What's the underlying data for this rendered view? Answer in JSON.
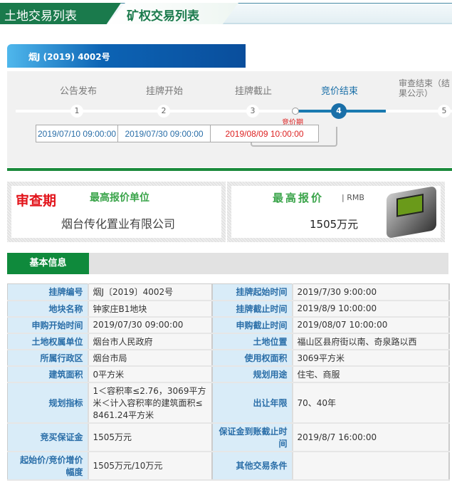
{
  "tabs": [
    "土地交易列表",
    "矿权交易列表"
  ],
  "title": "烟J (2019) 4002号",
  "steps": [
    {
      "label": "公告发布",
      "num": "1",
      "date": "2019/07/10 09:00:00"
    },
    {
      "label": "挂牌开始",
      "num": "2",
      "date": "2019/07/30 09:00:00"
    },
    {
      "label": "挂牌截止",
      "num": "3",
      "date": "2019/08/09 10:00:00"
    },
    {
      "label": "竞价结束",
      "num": "4"
    },
    {
      "label": "审查结束（结果公示）",
      "num": "5"
    }
  ],
  "bidding_period": "竞价期",
  "result": {
    "status": "审查期",
    "winner_label": "最高报价单位",
    "winner": "烟台传化置业有限公司",
    "price_label": "最高报价",
    "currency": "| RMB",
    "price": "1505万元"
  },
  "section": "基本信息",
  "rows": [
    [
      {
        "k": "挂牌编号",
        "v": "烟J〔2019〕4002号"
      },
      {
        "k": "挂牌起始时间",
        "v": "2019/7/30 9:00:00"
      }
    ],
    [
      {
        "k": "地块名称",
        "v": "钟家庄B1地块"
      },
      {
        "k": "挂牌截止时间",
        "v": "2019/8/9 10:00:00"
      }
    ],
    [
      {
        "k": "申购开始时间",
        "v": "2019/07/30 09:00:00"
      },
      {
        "k": "申购截止时间",
        "v": "2019/08/07 10:00:00"
      }
    ],
    [
      {
        "k": "土地权属单位",
        "v": "烟台市人民政府"
      },
      {
        "k": "土地位置",
        "v": "福山区县府街以南、奇泉路以西"
      }
    ],
    [
      {
        "k": "所属行政区",
        "v": "烟台市局"
      },
      {
        "k": "使用权面积",
        "v": "3069平方米"
      }
    ],
    [
      {
        "k": "建筑面积",
        "v": "0平方米"
      },
      {
        "k": "规划用途",
        "v": "住宅、商服"
      }
    ],
    [
      {
        "k": "规划指标",
        "v": "1＜容积率≤2.76，3069平方米＜计入容积率的建筑面积≤8461.24平方米"
      },
      {
        "k": "出让年限",
        "v": "70、40年"
      }
    ],
    [
      {
        "k": "竞买保证金",
        "v": "1505万元"
      },
      {
        "k": "保证金到账截止时间",
        "v": "2019/8/7 16:00:00"
      }
    ],
    [
      {
        "k": "起始价/竞价增价幅度",
        "v": "1505万元/10万元"
      },
      {
        "k": "其他交易条件",
        "v": ""
      }
    ]
  ]
}
